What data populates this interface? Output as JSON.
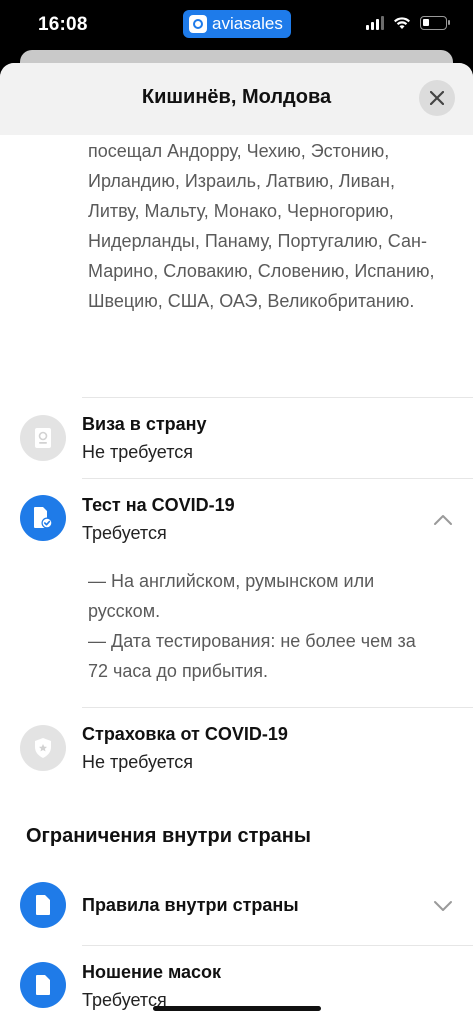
{
  "status_bar": {
    "time": "16:08",
    "app_pill": "aviasales"
  },
  "header": {
    "title": "Кишинёв, Молдова"
  },
  "visited_text": "посещал Андорру, Чехию, Эстонию, Ирландию, Израиль, Латвию, Ливан, Литву, Мальту, Монако, Черногорию, Нидерланды, Панаму, Португалию, Сан-Марино, Словакию, Словению, Испанию, Швецию, США, ОАЭ, Великобританию.",
  "rows": [
    {
      "title": "Виза в страну",
      "status": "Не требуется",
      "icon": "passport-icon"
    },
    {
      "title": "Тест на COVID-19",
      "status": "Требуется",
      "icon": "test-document-icon",
      "expanded": true,
      "details": [
        "— На английском, румынском или русском.",
        "— Дата тестирования: не более чем за 72 часа до прибытия."
      ]
    },
    {
      "title": "Страховка от COVID-19",
      "status": "Не требуется",
      "icon": "shield-icon"
    }
  ],
  "section": {
    "title": "Ограничения внутри страны",
    "items": [
      {
        "title": "Правила внутри страны",
        "icon": "document-icon"
      },
      {
        "title": "Ношение масок",
        "status": "Требуется",
        "icon": "document-icon"
      }
    ]
  },
  "colors": {
    "accent": "#1f7be8",
    "pill": "#1e7bea",
    "icon_gray": "#e3e3e3"
  }
}
